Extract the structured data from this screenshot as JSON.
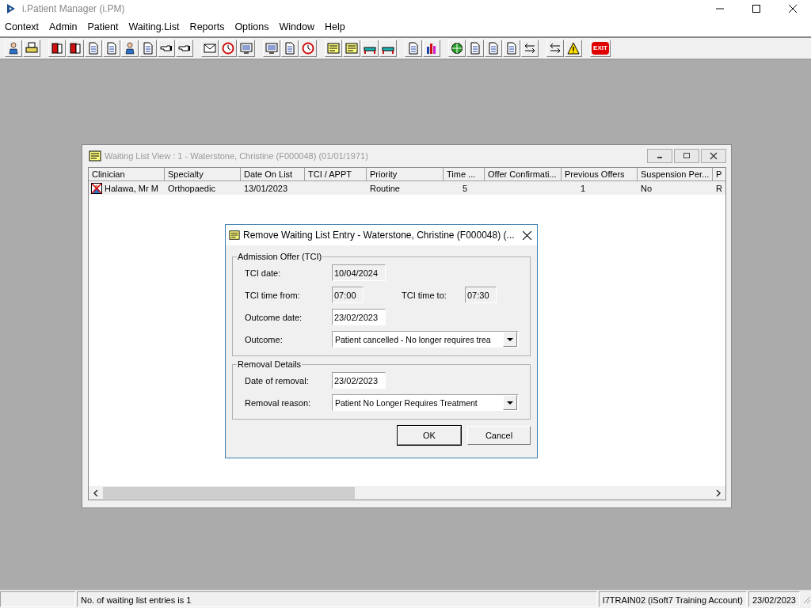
{
  "app": {
    "title": "i.Patient Manager (i.PM)"
  },
  "menu": [
    "Context",
    "Admin",
    "Patient",
    "Waiting.List",
    "Reports",
    "Options",
    "Window",
    "Help"
  ],
  "toolbar": {
    "exit_label": "EXIT"
  },
  "child_window": {
    "title": "Waiting List View :  1 - Waterstone, Christine (F000048) (01/01/1971)",
    "active": false,
    "columns": [
      "Clinician",
      "Specialty",
      "Date On List",
      "TCI / APPT",
      "Priority",
      "Time ...",
      "Offer Confirmati...",
      "Previous Offers",
      "Suspension Per...",
      "P"
    ],
    "rows": [
      {
        "selected": true,
        "cells": [
          "Halawa, Mr M",
          "Orthopaedic",
          "13/01/2023",
          "",
          "Routine",
          "5",
          "",
          "1",
          "No",
          "R"
        ]
      }
    ]
  },
  "dialog": {
    "title": "Remove Waiting List Entry - Waterstone, Christine (F000048) (...",
    "groups": [
      {
        "legend": "Admission Offer (TCI)",
        "rows": [
          [
            {
              "label": "TCI date:",
              "value": "10/04/2024",
              "kind": "text",
              "readonly": true
            }
          ],
          [
            {
              "label": "TCI time from:",
              "value": "07:00",
              "kind": "time",
              "readonly": true
            },
            {
              "label": "TCI time to:",
              "value": "07:30",
              "kind": "time",
              "readonly": true
            }
          ],
          [
            {
              "label": "Outcome date:",
              "value": "23/02/2023",
              "kind": "text",
              "readonly": false
            }
          ],
          [
            {
              "label": "Outcome:",
              "value": "Patient cancelled - No longer requires trea",
              "kind": "dropdown",
              "readonly": false
            }
          ]
        ]
      },
      {
        "legend": "Removal Details",
        "rows": [
          [
            {
              "label": "Date of removal:",
              "value": "23/02/2023",
              "kind": "text",
              "readonly": false
            }
          ],
          [
            {
              "label": "Removal reason:",
              "value": "Patient No Longer Requires Treatment",
              "kind": "dropdown",
              "readonly": false
            }
          ]
        ]
      }
    ],
    "buttons": [
      {
        "label": "OK",
        "default": true
      },
      {
        "label": "Cancel",
        "default": false
      }
    ]
  },
  "status_bar": [
    "No. of waiting list entries is 1",
    "I7TRAIN02 (iSoft7 Training Account)",
    "23/02/2023"
  ]
}
